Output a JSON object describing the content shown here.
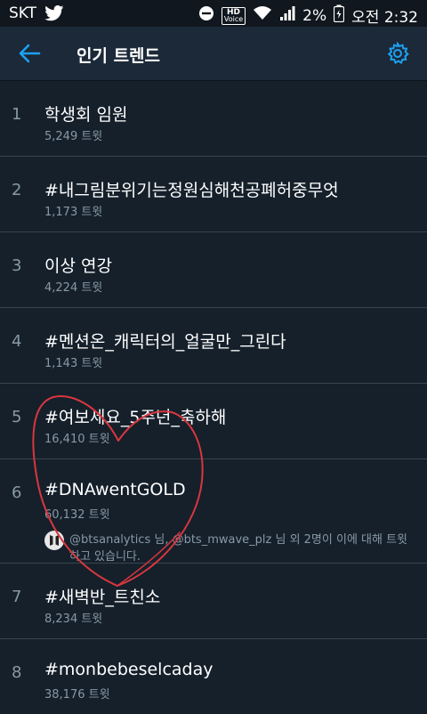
{
  "status_bar": {
    "carrier": "SKT",
    "hd_label": "HD",
    "voice_label": "Voice",
    "battery": "2%",
    "time": "오전 2:32"
  },
  "app_bar": {
    "title": "인기 트렌드",
    "back_icon": "arrow-left-icon",
    "settings_icon": "gear-icon",
    "accent_color": "#1da1f2"
  },
  "trends": [
    {
      "rank": "1",
      "name": "학생회 임원",
      "count": "5,249 트윗"
    },
    {
      "rank": "2",
      "name": "#내그림분위기는정원심해천공폐허중무엇",
      "count": "1,173 트윗"
    },
    {
      "rank": "3",
      "name": "이상 연강",
      "count": "4,224 트윗"
    },
    {
      "rank": "4",
      "name": "#멘션온_캐릭터의_얼굴만_그린다",
      "count": "1,143 트윗"
    },
    {
      "rank": "5",
      "name": "#여보세요_5주년_축하해",
      "count": "16,410 트윗"
    },
    {
      "rank": "6",
      "name": "#DNAwentGOLD",
      "count": "60,132 트윗",
      "context": "@btsanalytics 님, @bts_mwave_plz 님 외 2명이 이에 대해 트윗하고 있습니다."
    },
    {
      "rank": "7",
      "name": "#새벽반_트친소",
      "count": "8,234 트윗"
    },
    {
      "rank": "8",
      "name": "#monbebeselcaday",
      "count": "38,176 트윗"
    }
  ],
  "overlay": {
    "type": "hand-drawn-heart",
    "color": "#d9363e"
  }
}
